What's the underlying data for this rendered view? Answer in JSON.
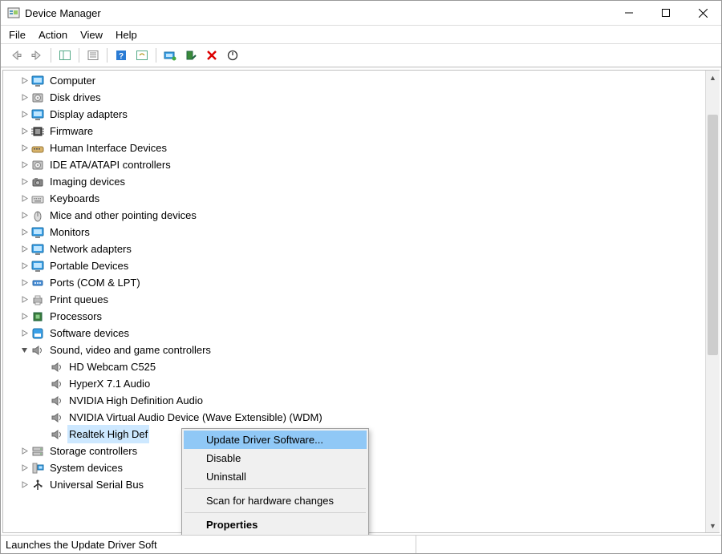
{
  "window": {
    "title": "Device Manager"
  },
  "menu": {
    "file": "File",
    "action": "Action",
    "view": "View",
    "help": "Help"
  },
  "tree": [
    {
      "id": "computer",
      "label": "Computer",
      "expanded": false,
      "icon": "monitor"
    },
    {
      "id": "diskdrives",
      "label": "Disk drives",
      "expanded": false,
      "icon": "disk"
    },
    {
      "id": "display",
      "label": "Display adapters",
      "expanded": false,
      "icon": "monitor"
    },
    {
      "id": "firmware",
      "label": "Firmware",
      "expanded": false,
      "icon": "chip"
    },
    {
      "id": "hid",
      "label": "Human Interface Devices",
      "expanded": false,
      "icon": "hid"
    },
    {
      "id": "ide",
      "label": "IDE ATA/ATAPI controllers",
      "expanded": false,
      "icon": "disk"
    },
    {
      "id": "imaging",
      "label": "Imaging devices",
      "expanded": false,
      "icon": "camera"
    },
    {
      "id": "keyboards",
      "label": "Keyboards",
      "expanded": false,
      "icon": "keyboard"
    },
    {
      "id": "mice",
      "label": "Mice and other pointing devices",
      "expanded": false,
      "icon": "mouse"
    },
    {
      "id": "monitors",
      "label": "Monitors",
      "expanded": false,
      "icon": "monitor"
    },
    {
      "id": "network",
      "label": "Network adapters",
      "expanded": false,
      "icon": "monitor"
    },
    {
      "id": "portable",
      "label": "Portable Devices",
      "expanded": false,
      "icon": "monitor"
    },
    {
      "id": "ports",
      "label": "Ports (COM & LPT)",
      "expanded": false,
      "icon": "port"
    },
    {
      "id": "printq",
      "label": "Print queues",
      "expanded": false,
      "icon": "printer"
    },
    {
      "id": "proc",
      "label": "Processors",
      "expanded": false,
      "icon": "cpu"
    },
    {
      "id": "softdev",
      "label": "Software devices",
      "expanded": false,
      "icon": "soft"
    },
    {
      "id": "sound",
      "label": "Sound, video and game controllers",
      "expanded": true,
      "icon": "speaker",
      "children": [
        {
          "label": "HD Webcam C525"
        },
        {
          "label": "HyperX 7.1 Audio"
        },
        {
          "label": "NVIDIA High Definition Audio"
        },
        {
          "label": "NVIDIA Virtual Audio Device (Wave Extensible) (WDM)"
        },
        {
          "label": "Realtek High Def",
          "selected": true
        }
      ]
    },
    {
      "id": "storage",
      "label": "Storage controllers",
      "expanded": false,
      "icon": "storage"
    },
    {
      "id": "system",
      "label": "System devices",
      "expanded": false,
      "icon": "system"
    },
    {
      "id": "usb",
      "label": "Universal Serial Bus",
      "expanded": false,
      "icon": "usb"
    }
  ],
  "contextMenu": {
    "updateDriver": "Update Driver Software...",
    "disable": "Disable",
    "uninstall": "Uninstall",
    "scan": "Scan for hardware changes",
    "properties": "Properties"
  },
  "status": "Launches the Update Driver Soft"
}
